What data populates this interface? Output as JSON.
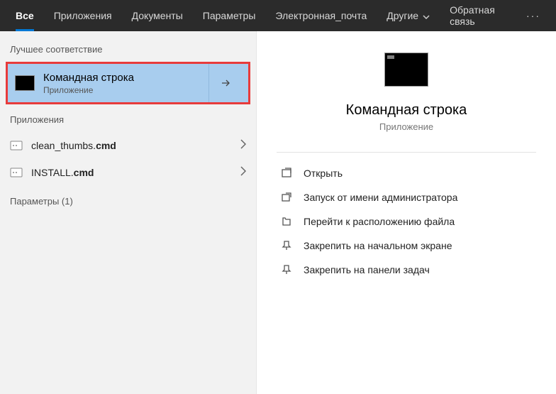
{
  "tabs": {
    "all": "Все",
    "apps": "Приложения",
    "docs": "Документы",
    "params": "Параметры",
    "email": "Электронная_почта",
    "other": "Другие",
    "feedback": "Обратная связь"
  },
  "left": {
    "best_match_header": "Лучшее соответствие",
    "best_match": {
      "title": "Командная строка",
      "subtitle": "Приложение"
    },
    "apps_header": "Приложения",
    "app_items": [
      {
        "prefix": "clean_thumbs.",
        "bold": "cmd"
      },
      {
        "prefix": "INSTALL.",
        "bold": "cmd"
      }
    ],
    "params_header": "Параметры (1)"
  },
  "preview": {
    "title": "Командная строка",
    "subtitle": "Приложение",
    "actions": {
      "open": "Открыть",
      "run_admin": "Запуск от имени администратора",
      "file_location": "Перейти к расположению файла",
      "pin_start": "Закрепить на начальном экране",
      "pin_taskbar": "Закрепить на панели задач"
    }
  }
}
